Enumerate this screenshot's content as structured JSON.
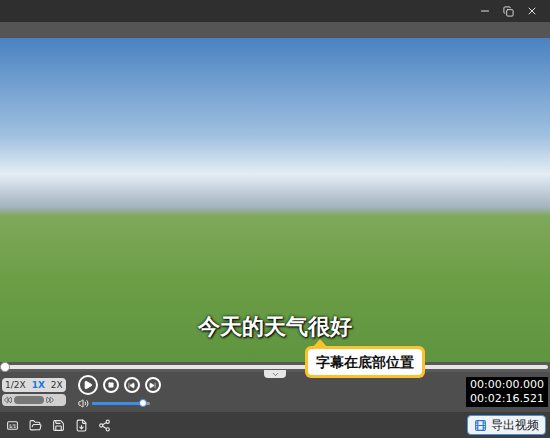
{
  "video": {
    "subtitle": "今天的天气很好"
  },
  "timeline": {
    "level": 0
  },
  "callout": {
    "text": "字幕在底部位置"
  },
  "speeds": [
    {
      "label": "1/2X",
      "selected": false
    },
    {
      "label": "1X",
      "selected": true
    },
    {
      "label": "2X",
      "selected": false
    }
  ],
  "volume": {
    "level": 0.88
  },
  "time": {
    "current": "00:00:00.000",
    "total": "00:02:16.521"
  },
  "export_button": {
    "label": "导出视频"
  }
}
